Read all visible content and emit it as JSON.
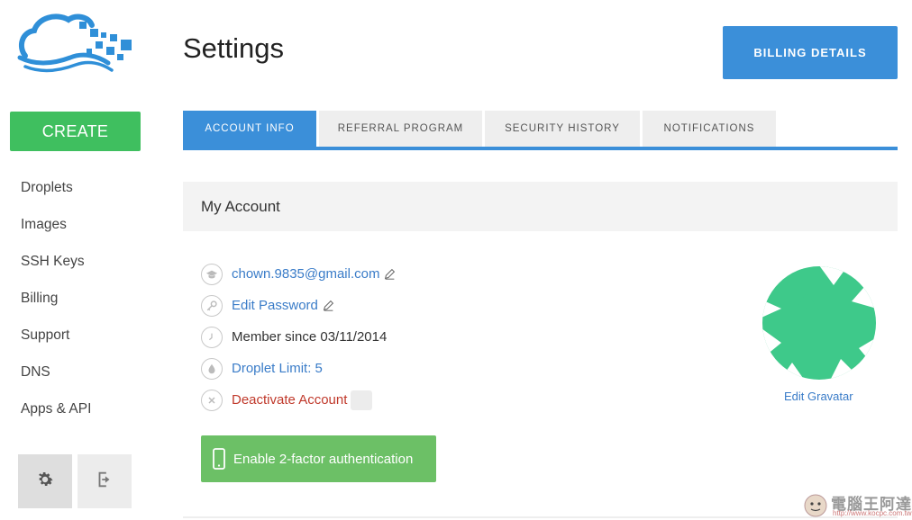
{
  "brand": {
    "accent": "#3b8fd9",
    "create_green": "#3fbf5f",
    "twofa_green": "#6cc066",
    "danger": "#c0392b"
  },
  "sidebar": {
    "create_label": "CREATE",
    "items": [
      {
        "label": "Droplets"
      },
      {
        "label": "Images"
      },
      {
        "label": "SSH Keys"
      },
      {
        "label": "Billing"
      },
      {
        "label": "Support"
      },
      {
        "label": "DNS"
      },
      {
        "label": "Apps & API"
      }
    ],
    "settings_icon": "gear-icon",
    "logout_icon": "logout-icon"
  },
  "header": {
    "title": "Settings",
    "billing_label": "BILLING DETAILS"
  },
  "tabs": [
    {
      "label": "ACCOUNT INFO",
      "active": true
    },
    {
      "label": "REFERRAL PROGRAM",
      "active": false
    },
    {
      "label": "SECURITY HISTORY",
      "active": false
    },
    {
      "label": "NOTIFICATIONS",
      "active": false
    }
  ],
  "account": {
    "section_title": "My Account",
    "email": "chown.9835@gmail.com",
    "edit_password": "Edit Password",
    "member_since": "Member since 03/11/2014",
    "droplet_limit": "Droplet Limit: 5",
    "deactivate": "Deactivate Account",
    "twofa_label": "Enable 2-factor authentication",
    "edit_gravatar": "Edit Gravatar"
  },
  "watermark": {
    "title": "電腦王阿達",
    "url": "http://www.kocpc.com.tw"
  }
}
